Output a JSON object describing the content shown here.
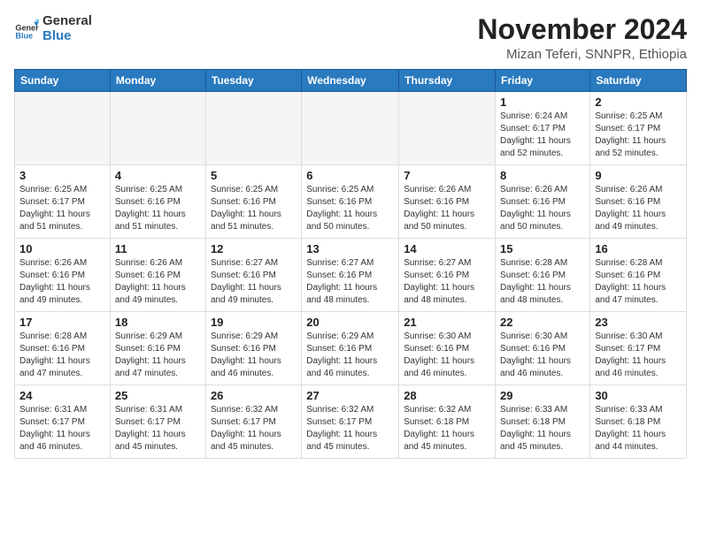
{
  "header": {
    "logo_general": "General",
    "logo_blue": "Blue",
    "month_title": "November 2024",
    "location": "Mizan Teferi, SNNPR, Ethiopia"
  },
  "days_of_week": [
    "Sunday",
    "Monday",
    "Tuesday",
    "Wednesday",
    "Thursday",
    "Friday",
    "Saturday"
  ],
  "weeks": [
    [
      {
        "day": "",
        "info": ""
      },
      {
        "day": "",
        "info": ""
      },
      {
        "day": "",
        "info": ""
      },
      {
        "day": "",
        "info": ""
      },
      {
        "day": "",
        "info": ""
      },
      {
        "day": "1",
        "info": "Sunrise: 6:24 AM\nSunset: 6:17 PM\nDaylight: 11 hours\nand 52 minutes."
      },
      {
        "day": "2",
        "info": "Sunrise: 6:25 AM\nSunset: 6:17 PM\nDaylight: 11 hours\nand 52 minutes."
      }
    ],
    [
      {
        "day": "3",
        "info": "Sunrise: 6:25 AM\nSunset: 6:17 PM\nDaylight: 11 hours\nand 51 minutes."
      },
      {
        "day": "4",
        "info": "Sunrise: 6:25 AM\nSunset: 6:16 PM\nDaylight: 11 hours\nand 51 minutes."
      },
      {
        "day": "5",
        "info": "Sunrise: 6:25 AM\nSunset: 6:16 PM\nDaylight: 11 hours\nand 51 minutes."
      },
      {
        "day": "6",
        "info": "Sunrise: 6:25 AM\nSunset: 6:16 PM\nDaylight: 11 hours\nand 50 minutes."
      },
      {
        "day": "7",
        "info": "Sunrise: 6:26 AM\nSunset: 6:16 PM\nDaylight: 11 hours\nand 50 minutes."
      },
      {
        "day": "8",
        "info": "Sunrise: 6:26 AM\nSunset: 6:16 PM\nDaylight: 11 hours\nand 50 minutes."
      },
      {
        "day": "9",
        "info": "Sunrise: 6:26 AM\nSunset: 6:16 PM\nDaylight: 11 hours\nand 49 minutes."
      }
    ],
    [
      {
        "day": "10",
        "info": "Sunrise: 6:26 AM\nSunset: 6:16 PM\nDaylight: 11 hours\nand 49 minutes."
      },
      {
        "day": "11",
        "info": "Sunrise: 6:26 AM\nSunset: 6:16 PM\nDaylight: 11 hours\nand 49 minutes."
      },
      {
        "day": "12",
        "info": "Sunrise: 6:27 AM\nSunset: 6:16 PM\nDaylight: 11 hours\nand 49 minutes."
      },
      {
        "day": "13",
        "info": "Sunrise: 6:27 AM\nSunset: 6:16 PM\nDaylight: 11 hours\nand 48 minutes."
      },
      {
        "day": "14",
        "info": "Sunrise: 6:27 AM\nSunset: 6:16 PM\nDaylight: 11 hours\nand 48 minutes."
      },
      {
        "day": "15",
        "info": "Sunrise: 6:28 AM\nSunset: 6:16 PM\nDaylight: 11 hours\nand 48 minutes."
      },
      {
        "day": "16",
        "info": "Sunrise: 6:28 AM\nSunset: 6:16 PM\nDaylight: 11 hours\nand 47 minutes."
      }
    ],
    [
      {
        "day": "17",
        "info": "Sunrise: 6:28 AM\nSunset: 6:16 PM\nDaylight: 11 hours\nand 47 minutes."
      },
      {
        "day": "18",
        "info": "Sunrise: 6:29 AM\nSunset: 6:16 PM\nDaylight: 11 hours\nand 47 minutes."
      },
      {
        "day": "19",
        "info": "Sunrise: 6:29 AM\nSunset: 6:16 PM\nDaylight: 11 hours\nand 46 minutes."
      },
      {
        "day": "20",
        "info": "Sunrise: 6:29 AM\nSunset: 6:16 PM\nDaylight: 11 hours\nand 46 minutes."
      },
      {
        "day": "21",
        "info": "Sunrise: 6:30 AM\nSunset: 6:16 PM\nDaylight: 11 hours\nand 46 minutes."
      },
      {
        "day": "22",
        "info": "Sunrise: 6:30 AM\nSunset: 6:16 PM\nDaylight: 11 hours\nand 46 minutes."
      },
      {
        "day": "23",
        "info": "Sunrise: 6:30 AM\nSunset: 6:17 PM\nDaylight: 11 hours\nand 46 minutes."
      }
    ],
    [
      {
        "day": "24",
        "info": "Sunrise: 6:31 AM\nSunset: 6:17 PM\nDaylight: 11 hours\nand 46 minutes."
      },
      {
        "day": "25",
        "info": "Sunrise: 6:31 AM\nSunset: 6:17 PM\nDaylight: 11 hours\nand 45 minutes."
      },
      {
        "day": "26",
        "info": "Sunrise: 6:32 AM\nSunset: 6:17 PM\nDaylight: 11 hours\nand 45 minutes."
      },
      {
        "day": "27",
        "info": "Sunrise: 6:32 AM\nSunset: 6:17 PM\nDaylight: 11 hours\nand 45 minutes."
      },
      {
        "day": "28",
        "info": "Sunrise: 6:32 AM\nSunset: 6:18 PM\nDaylight: 11 hours\nand 45 minutes."
      },
      {
        "day": "29",
        "info": "Sunrise: 6:33 AM\nSunset: 6:18 PM\nDaylight: 11 hours\nand 45 minutes."
      },
      {
        "day": "30",
        "info": "Sunrise: 6:33 AM\nSunset: 6:18 PM\nDaylight: 11 hours\nand 44 minutes."
      }
    ]
  ]
}
